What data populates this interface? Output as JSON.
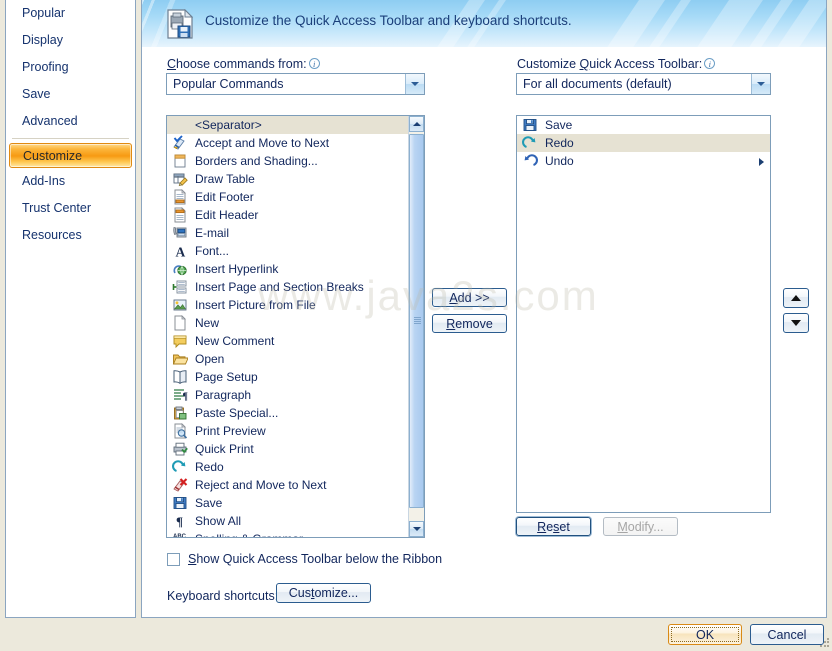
{
  "colors": {
    "accent_orange": "#f79a12",
    "banner_blue": "#8ecdf2",
    "dialog_beige": "#ece9dc",
    "text_navy": "#11265c",
    "selection_beige": "#e6e2d3"
  },
  "sidebar": {
    "items": [
      {
        "label": "Popular",
        "selected": false,
        "sep_after": false
      },
      {
        "label": "Display",
        "selected": false,
        "sep_after": false
      },
      {
        "label": "Proofing",
        "selected": false,
        "sep_after": false
      },
      {
        "label": "Save",
        "selected": false,
        "sep_after": false
      },
      {
        "label": "Advanced",
        "selected": false,
        "sep_after": true
      },
      {
        "label": "Customize",
        "selected": true,
        "sep_after": false
      },
      {
        "label": "Add-Ins",
        "selected": false,
        "sep_after": false
      },
      {
        "label": "Trust Center",
        "selected": false,
        "sep_after": false
      },
      {
        "label": "Resources",
        "selected": false,
        "sep_after": false
      }
    ]
  },
  "banner": {
    "title": "Customize the Quick Access Toolbar and keyboard shortcuts.",
    "icon": "customize-quick-access-toolbar-icon"
  },
  "left_panel": {
    "label_prefix": "C",
    "label_rest": "hoose commands from:",
    "combo_value": "Popular Commands",
    "commands": [
      {
        "label": "<Separator>",
        "icon": "separator-icon",
        "selected": true,
        "has_submenu": false
      },
      {
        "label": "Accept and Move to Next",
        "icon": "accept-change-icon",
        "selected": false,
        "has_submenu": false
      },
      {
        "label": "Borders and Shading...",
        "icon": "borders-shading-icon",
        "selected": false,
        "has_submenu": false
      },
      {
        "label": "Draw Table",
        "icon": "draw-table-icon",
        "selected": false,
        "has_submenu": false
      },
      {
        "label": "Edit Footer",
        "icon": "edit-footer-icon",
        "selected": false,
        "has_submenu": false
      },
      {
        "label": "Edit Header",
        "icon": "edit-header-icon",
        "selected": false,
        "has_submenu": false
      },
      {
        "label": "E-mail",
        "icon": "email-icon",
        "selected": false,
        "has_submenu": false
      },
      {
        "label": "Font...",
        "icon": "font-icon",
        "selected": false,
        "has_submenu": false
      },
      {
        "label": "Insert Hyperlink",
        "icon": "hyperlink-icon",
        "selected": false,
        "has_submenu": false
      },
      {
        "label": "Insert Page and Section Breaks",
        "icon": "page-break-icon",
        "selected": false,
        "has_submenu": true
      },
      {
        "label": "Insert Picture from File",
        "icon": "picture-icon",
        "selected": false,
        "has_submenu": false
      },
      {
        "label": "New",
        "icon": "new-document-icon",
        "selected": false,
        "has_submenu": false
      },
      {
        "label": "New Comment",
        "icon": "new-comment-icon",
        "selected": false,
        "has_submenu": false
      },
      {
        "label": "Open",
        "icon": "open-folder-icon",
        "selected": false,
        "has_submenu": false
      },
      {
        "label": "Page Setup",
        "icon": "page-setup-icon",
        "selected": false,
        "has_submenu": false
      },
      {
        "label": "Paragraph",
        "icon": "paragraph-icon",
        "selected": false,
        "has_submenu": false
      },
      {
        "label": "Paste Special...",
        "icon": "paste-special-icon",
        "selected": false,
        "has_submenu": false
      },
      {
        "label": "Print Preview",
        "icon": "print-preview-icon",
        "selected": false,
        "has_submenu": false
      },
      {
        "label": "Quick Print",
        "icon": "quick-print-icon",
        "selected": false,
        "has_submenu": false
      },
      {
        "label": "Redo",
        "icon": "redo-icon",
        "selected": false,
        "has_submenu": false
      },
      {
        "label": "Reject and Move to Next",
        "icon": "reject-change-icon",
        "selected": false,
        "has_submenu": false
      },
      {
        "label": "Save",
        "icon": "save-icon",
        "selected": false,
        "has_submenu": false
      },
      {
        "label": "Show All",
        "icon": "show-all-icon",
        "selected": false,
        "has_submenu": false
      },
      {
        "label": "Spelling & Grammar...",
        "icon": "spelling-grammar-icon",
        "selected": false,
        "has_submenu": false
      }
    ]
  },
  "middle_buttons": {
    "add_label": "Add >>",
    "remove_label": "Remove"
  },
  "right_panel": {
    "label_pre": "Customize ",
    "label_q": "Q",
    "label_post": "uick Access Toolbar:",
    "combo_value": "For all documents (default)",
    "items": [
      {
        "label": "Save",
        "icon": "save-icon",
        "selected": false,
        "has_submenu": false
      },
      {
        "label": "Redo",
        "icon": "redo-icon",
        "selected": true,
        "has_submenu": false
      },
      {
        "label": "Undo",
        "icon": "undo-icon",
        "selected": false,
        "has_submenu": true
      }
    ],
    "reset_label": "Reset",
    "modify_label": "Modify...",
    "modify_disabled": true
  },
  "reorder": {
    "move_up_icon": "arrow-up-icon",
    "move_down_icon": "arrow-down-icon"
  },
  "checkbox": {
    "label_pre": "S",
    "label_rest": "how Quick Access Toolbar below the Ribbon",
    "checked": false
  },
  "keyboard": {
    "label": "Keyboard shortcuts:",
    "button_label": "Customize..."
  },
  "dialog_buttons": {
    "ok_label": "OK",
    "cancel_label": "Cancel"
  },
  "watermark": {
    "text": "www.java2s.com"
  }
}
